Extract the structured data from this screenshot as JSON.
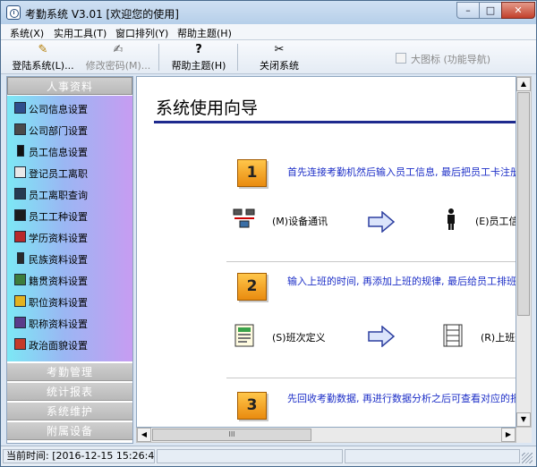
{
  "window": {
    "title": "考勤系统 V3.01 [欢迎您的使用]",
    "controls": {
      "minimize": "–",
      "maximize": "□",
      "close": "✕"
    }
  },
  "menu": [
    "系统(X)",
    "实用工具(T)",
    "窗口排列(Y)",
    "帮助主题(H)"
  ],
  "toolbar": {
    "buttons": [
      {
        "label": "登陆系统(L)...",
        "icon": "✎"
      },
      {
        "label": "修改密码(M)...",
        "icon": "✍"
      },
      {
        "label": "帮助主题(H)",
        "icon": "?"
      },
      {
        "label": "关闭系统",
        "icon": "✂"
      }
    ],
    "big_icon_option": "大图标 (功能导航)"
  },
  "sidebar": {
    "categories": [
      "人事资料",
      "考勤管理",
      "统计报表",
      "系统维护",
      "附属设备"
    ],
    "items": [
      "公司信息设置",
      "公司部门设置",
      "员工信息设置",
      "登记员工离职",
      "员工离职查询",
      "员工工种设置",
      "学历资料设置",
      "民族资料设置",
      "籍贯资料设置",
      "职位资料设置",
      "职称资料设置",
      "政治面貌设置"
    ]
  },
  "content": {
    "title": "系统使用向导",
    "steps": [
      {
        "number": "1",
        "text": "首先连接考勤机然后输入员工信息, 最后把员工卡注册到",
        "left_label": "(M)设备通讯",
        "right_label": "(E)员工信息"
      },
      {
        "number": "2",
        "text": "输入上班的时间, 再添加上班的规律, 最后给员工排班.",
        "left_label": "(S)班次定义",
        "right_label": "(R)上班规"
      },
      {
        "number": "3",
        "text": "先回收考勤数据, 再进行数据分析之后可查看对应的报表"
      }
    ],
    "scroll": {
      "up": "▲",
      "down": "▼",
      "left": "◀",
      "right": "▶",
      "grip": "III"
    }
  },
  "status": {
    "time": "当前时间: [2016-12-15 15:26:42]"
  },
  "colors": {
    "accent_blue": "#1c2ec7",
    "title_rule": "#1e2a8e",
    "step_badge": "#f0a020"
  }
}
